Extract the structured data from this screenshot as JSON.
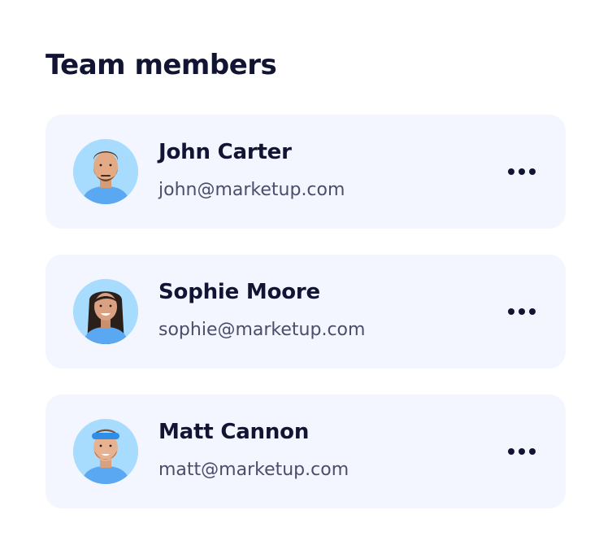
{
  "page": {
    "title": "Team members"
  },
  "members": [
    {
      "name": "John Carter",
      "email": "john@marketup.com",
      "avatar_icon": "avatar-john-carter",
      "more_icon": "more-horizontal-icon"
    },
    {
      "name": "Sophie Moore",
      "email": "sophie@marketup.com",
      "avatar_icon": "avatar-sophie-moore",
      "more_icon": "more-horizontal-icon"
    },
    {
      "name": "Matt Cannon",
      "email": "matt@marketup.com",
      "avatar_icon": "avatar-matt-cannon",
      "more_icon": "more-horizontal-icon"
    }
  ],
  "colors": {
    "heading": "#121433",
    "email_text": "#4b4e6a",
    "card_background": "#f3f6ff",
    "avatar_background": "#a8dcff",
    "shirt_blue": "#5aa7f2",
    "headband_blue": "#2f8fe8"
  }
}
